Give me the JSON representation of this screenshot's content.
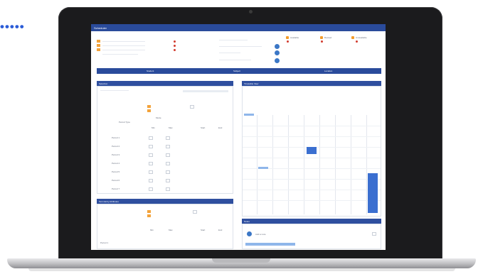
{
  "decor": {
    "dots": "•••••"
  },
  "app": {
    "title": "Scheduler",
    "accent": "#2a4b9b",
    "orange": "#f39c2b",
    "red": "#d23a2d"
  },
  "tabs": [
    "Student",
    "Subject",
    "Location"
  ],
  "panels": {
    "left_top": "Selection",
    "left_bottom": "Term Entry Attributes",
    "right_top": "Timetable View",
    "right_bottom": "Notes"
  },
  "legend": [
    "Available",
    "Booked",
    "Unavailable"
  ],
  "form": {
    "period_header": "Period Type",
    "mode_header": "Mode",
    "col_min": "Min",
    "col_max": "Max",
    "col_start": "Start",
    "col_end": "End",
    "rows": [
      "Period 1",
      "Period 2",
      "Period 3",
      "Period 4",
      "Period 5",
      "Period 6",
      "Period 7"
    ]
  },
  "notes": {
    "placeholder": "Add a note"
  },
  "colors": {
    "slot": "#3b6fd0",
    "slot_light": "#8fb6ea"
  }
}
